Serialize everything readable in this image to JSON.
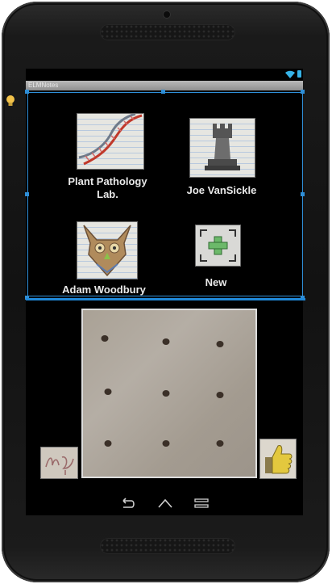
{
  "app": {
    "title": "ELMNotes"
  },
  "contacts": [
    {
      "name": "Plant Pathology Lab.",
      "icon": "dna-drawing-icon"
    },
    {
      "name": "Joe VanSickle",
      "icon": "rook-drawing-icon"
    },
    {
      "name": "Adam Woodbury",
      "icon": "owl-drawing-icon"
    },
    {
      "name": "New",
      "icon": "add-contact-icon"
    }
  ],
  "gesture_board": {
    "dots": 9,
    "grid": "3x3"
  },
  "side_buttons": {
    "left": "signature-drawing-icon",
    "right": "thumbs-up-icon"
  },
  "colors": {
    "selection": "#2f8fd8",
    "accent": "#36b3e7",
    "background": "#000000"
  },
  "nav": {
    "back": "back-icon",
    "home": "home-icon",
    "recents": "recents-icon"
  }
}
